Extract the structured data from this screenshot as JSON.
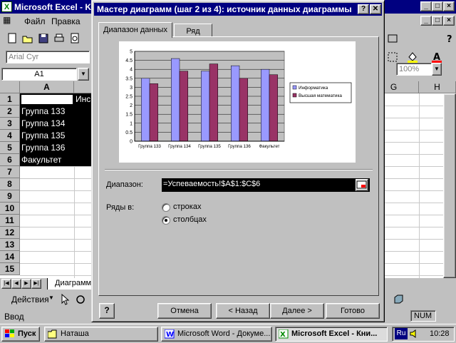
{
  "excel": {
    "title": "Microsoft Excel - K",
    "menu": [
      "Файл",
      "Правка"
    ],
    "font_name": "Arial Cyr",
    "zoom": "100%",
    "name_box": "A1",
    "columns": [
      "A",
      "G",
      "H"
    ],
    "col_b_partial": "Инс",
    "rows": [
      "1",
      "2",
      "3",
      "4",
      "5",
      "6",
      "7",
      "8",
      "9",
      "10",
      "11",
      "12",
      "13",
      "14",
      "15"
    ],
    "cells_a": [
      "",
      "Группа 133",
      "Группа 134",
      "Группа 135",
      "Группа 136",
      "Факультет"
    ],
    "sheet_tab": "Диаграмм",
    "actions_label": "Действия",
    "status_left": "Ввод",
    "status_num": "NUM"
  },
  "dialog": {
    "title": "Мастер диаграмм (шаг 2 из 4): источник данных диаграммы",
    "help_cap": "?",
    "close_cap": "✕",
    "tabs": [
      "Диапазон данных",
      "Ряд"
    ],
    "range_label": "Диапазон:",
    "range_value": "=Успеваемость!$A$1:$C$6",
    "series_in_label": "Ряды в:",
    "radio_rows": "строках",
    "radio_cols": "столбцах",
    "radio_selected": "столбцах",
    "help_button": "?",
    "buttons": {
      "cancel": "Отмена",
      "back": "< Назад",
      "next": "Далее >",
      "finish": "Готово"
    }
  },
  "taskbar": {
    "start": "Пуск",
    "tasks": [
      "Наташа",
      "Microsoft Word - Докуме...",
      "Microsoft Excel - Кни..."
    ],
    "lang": "Ru",
    "clock": "10:28"
  },
  "chart_data": {
    "type": "bar",
    "categories": [
      "Группа 133",
      "Группа 134",
      "Группа 135",
      "Группа 136",
      "Факультет"
    ],
    "series": [
      {
        "name": "Информатика",
        "values": [
          3.5,
          4.6,
          3.9,
          4.2,
          4.0
        ],
        "color": "#9999ff"
      },
      {
        "name": "Высшая математика",
        "values": [
          3.2,
          3.9,
          4.3,
          3.5,
          3.7
        ],
        "color": "#993366"
      }
    ],
    "ylim": [
      0,
      5
    ],
    "yticks": [
      "0",
      "0.5",
      "1",
      "1.5",
      "2",
      "2.5",
      "3",
      "3.5",
      "4",
      "4.5",
      "5"
    ],
    "plot_background": "#c0c0c0",
    "grid": true,
    "legend_position": "right"
  }
}
